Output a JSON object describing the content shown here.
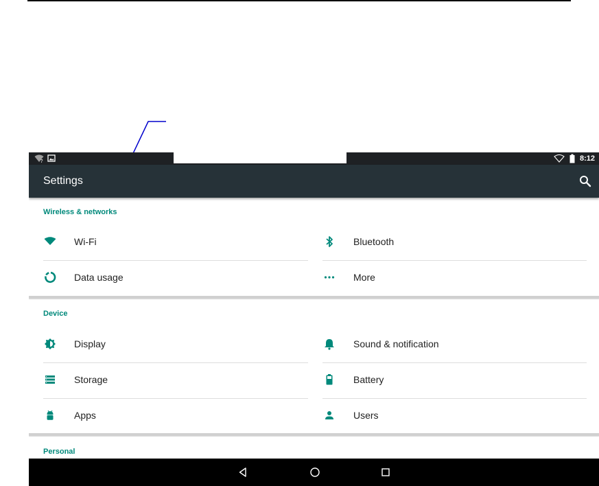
{
  "statusbar": {
    "time": "8:12",
    "left_icons": [
      "wifi-unknown-icon",
      "image-notification-icon"
    ],
    "right_icons": [
      "wifi-signal-icon",
      "battery-icon"
    ]
  },
  "appbar": {
    "title": "Settings",
    "search_icon": "search-icon"
  },
  "sections": [
    {
      "header": "Wireless & networks",
      "items": [
        {
          "label": "Wi-Fi",
          "icon": "wifi-icon"
        },
        {
          "label": "Bluetooth",
          "icon": "bluetooth-icon"
        },
        {
          "label": "Data usage",
          "icon": "data-usage-icon"
        },
        {
          "label": "More",
          "icon": "more-dots-icon"
        }
      ]
    },
    {
      "header": "Device",
      "items": [
        {
          "label": "Display",
          "icon": "display-brightness-icon"
        },
        {
          "label": "Sound & notification",
          "icon": "bell-icon"
        },
        {
          "label": "Storage",
          "icon": "storage-icon"
        },
        {
          "label": "Battery",
          "icon": "battery-icon"
        },
        {
          "label": "Apps",
          "icon": "android-apps-icon"
        },
        {
          "label": "Users",
          "icon": "user-icon"
        }
      ]
    },
    {
      "header": "Personal",
      "items": []
    }
  ],
  "navbar": {
    "buttons": [
      "back-icon",
      "home-icon",
      "recents-icon"
    ]
  },
  "colors": {
    "accent": "#00897b",
    "appbar": "#263238",
    "statusbar": "#1e2124",
    "navbar": "#000000"
  }
}
